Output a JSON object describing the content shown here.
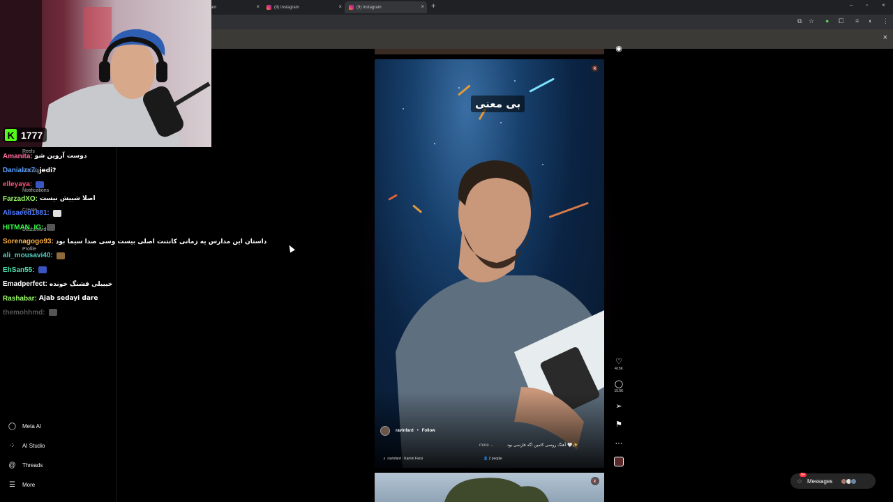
{
  "browser": {
    "tabs": [
      {
        "label": "am"
      },
      {
        "label": "(9) Instagram"
      },
      {
        "label": "(9) Instagram"
      }
    ],
    "new_tab": "+",
    "close_tab": "×",
    "window_controls": {
      "minimize": "–",
      "restore": "▫",
      "close": "×"
    }
  },
  "sidebar": {
    "items": [
      {
        "label": "Meta AI",
        "icon": "meta-ai-icon",
        "glyph": "◯"
      },
      {
        "label": "AI Studio",
        "icon": "ai-studio-icon",
        "glyph": "⁘"
      },
      {
        "label": "Threads",
        "icon": "threads-icon",
        "glyph": "@"
      },
      {
        "label": "More",
        "icon": "menu-icon",
        "glyph": "☰"
      }
    ],
    "ghost_items": [
      "Reels",
      "Messages",
      "Notifications",
      "Create",
      "Dashboard",
      "Profile"
    ]
  },
  "reel": {
    "overlay_text": "بی معنی",
    "author": "ravinfard",
    "separator": "•",
    "follow_label": "Follow",
    "caption": "آهنگ روسی کامین اگه فارسی بود 🤍✨",
    "more_label": "more ...",
    "audio": "♬ ravinfard · Kamin Farsi",
    "tagged": "👤 2 people",
    "mute_icon": "🔇"
  },
  "actions": {
    "likes": "415K",
    "comments": "15.6K"
  },
  "messages": {
    "label": "Messages",
    "badge": "9+"
  },
  "stream": {
    "viewer_count": "1777",
    "logo": "K"
  },
  "chat": [
    {
      "user": "Amanita:",
      "msg": "دوست آروین شو",
      "color": "#ff6b9e"
    },
    {
      "user": "Danialzx7:",
      "msg": "jedi?",
      "color": "#5aa0ff"
    },
    {
      "user": "elleyaya:",
      "msg": "",
      "color": "#ff5577"
    },
    {
      "user": "FarzadXO:",
      "msg": "اصلا شبیش نیست",
      "color": "#9cff6b"
    },
    {
      "user": "Alisaeed1881:",
      "msg": "",
      "color": "#4f7cff"
    },
    {
      "user": "HITMAN_IG:",
      "msg": "",
      "color": "#3cff4f"
    },
    {
      "user": "Sorenagogo93:",
      "msg": "داستان این مدارس یه زمانی کانتنت اصلی بیست وسی صدا سیما بود",
      "color": "#ffb347"
    },
    {
      "user": "ali_mousavi40:",
      "msg": "",
      "color": "#4fd0c0"
    },
    {
      "user": "EhSan55:",
      "msg": "",
      "color": "#4fe0b0"
    },
    {
      "user": "Emadperfect:",
      "msg": "خیییلی قشنگ خونده",
      "color": "#ffffff"
    },
    {
      "user": "Rashabar:",
      "msg": "Ajab sedayi dare",
      "color": "#9cff6b"
    },
    {
      "user": "themohhmd:",
      "msg": "",
      "color": "#555555"
    }
  ]
}
